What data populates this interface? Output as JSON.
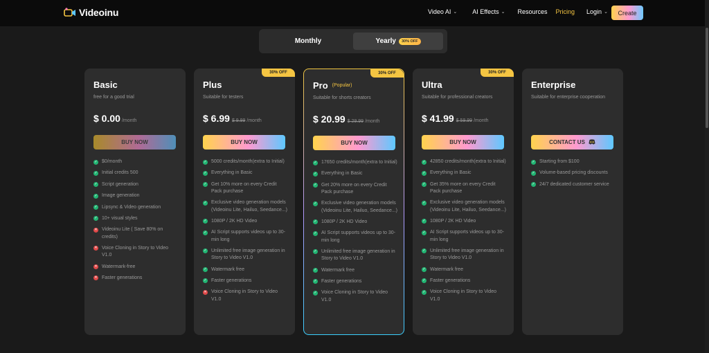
{
  "header": {
    "logo_text": "Videoinu",
    "nav": [
      {
        "label": "Video AI",
        "chevron": true,
        "active": false
      },
      {
        "label": "AI Effects",
        "chevron": true,
        "active": false
      },
      {
        "label": "Resources",
        "chevron": false,
        "active": false
      },
      {
        "label": "Pricing",
        "chevron": false,
        "active": true
      },
      {
        "label": "Login",
        "chevron": true,
        "active": false
      }
    ],
    "create_label": "Create"
  },
  "billing_toggle": {
    "monthly_label": "Monthly",
    "yearly_label": "Yearly",
    "yearly_badge": "30% OFF",
    "selected": "Yearly"
  },
  "plans": [
    {
      "name": "Basic",
      "popular": "",
      "badge": "",
      "description": "free for a good trial",
      "price": "$ 0.00",
      "old_price": "",
      "period": "/month",
      "button": "BUY NOW",
      "button_icon": "",
      "features": [
        {
          "text": "$0/month",
          "included": true
        },
        {
          "text": "Initial credits 500",
          "included": true
        },
        {
          "text": "Script generation",
          "included": true
        },
        {
          "text": "Image generation",
          "included": true
        },
        {
          "text": "Lipsync & Video generation",
          "included": true
        },
        {
          "text": "10+ visual styles",
          "included": true
        },
        {
          "text": "Videoinu Lite ( Save 80% on credits)",
          "included": false
        },
        {
          "text": "Voice Cloning in Story to Video V1.0",
          "included": false
        },
        {
          "text": "Watermark-free",
          "included": false
        },
        {
          "text": "Faster generations",
          "included": false
        }
      ]
    },
    {
      "name": "Plus",
      "popular": "",
      "badge": "30% OFF",
      "description": "Suitable for testers",
      "price": "$ 6.99",
      "old_price": "$ 9.99",
      "period": "/month",
      "button": "BUY NOW",
      "button_icon": "",
      "features": [
        {
          "text": "5000 credits/month(extra to Initial)",
          "included": true
        },
        {
          "text": "Everything in Basic",
          "included": true
        },
        {
          "text": "Get 10% more on every Credit Pack purchase",
          "included": true
        },
        {
          "text": "Exclusive video generation models (Videoinu Lite, Hailuo, Seedance...)",
          "included": true
        },
        {
          "text": "1080P / 2K HD Video",
          "included": true
        },
        {
          "text": "AI Script supports videos up to 30-min long",
          "included": true
        },
        {
          "text": "Unlimited free image generation in Story to Video V1.0",
          "included": true
        },
        {
          "text": "Watermark free",
          "included": true
        },
        {
          "text": "Faster generations",
          "included": true
        },
        {
          "text": "Voice Cloning in Story to Video V1.0",
          "included": false
        }
      ]
    },
    {
      "name": "Pro",
      "popular": "(Popular)",
      "badge": "30% OFF",
      "description": "Suitable for shorts creators",
      "price": "$ 20.99",
      "old_price": "$ 29.99",
      "period": "/month",
      "button": "BUY NOW",
      "button_icon": "",
      "features": [
        {
          "text": "17650 credits/month(extra to Initial)",
          "included": true
        },
        {
          "text": "Everything in Basic",
          "included": true
        },
        {
          "text": "Get 20% more on every Credit Pack purchase",
          "included": true
        },
        {
          "text": "Exclusive video generation models (Videoinu Lite, Hailuo, Seedance...)",
          "included": true
        },
        {
          "text": "1080P / 2K HD Video",
          "included": true
        },
        {
          "text": "AI Script supports videos up to 30-min long",
          "included": true
        },
        {
          "text": "Unlimited free image generation in Story to Video V1.0",
          "included": true
        },
        {
          "text": "Watermark free",
          "included": true
        },
        {
          "text": "Faster generations",
          "included": true
        },
        {
          "text": "Voice Cloning in Story to Video V1.0",
          "included": true
        }
      ]
    },
    {
      "name": "Ultra",
      "popular": "",
      "badge": "30% OFF",
      "description": "Suitable for professional creators",
      "price": "$ 41.99",
      "old_price": "$ 59.99",
      "period": "/month",
      "button": "BUY NOW",
      "button_icon": "",
      "features": [
        {
          "text": "42850 credits/month(extra to Initial)",
          "included": true
        },
        {
          "text": "Everything in Basic",
          "included": true
        },
        {
          "text": "Get 35% more on every Credit Pack purchase",
          "included": true
        },
        {
          "text": "Exclusive video generation models (Videoinu Lite, Hailuo, Seedance...)",
          "included": true
        },
        {
          "text": "1080P / 2K HD Video",
          "included": true
        },
        {
          "text": "AI Script supports videos up to 30-min long",
          "included": true
        },
        {
          "text": "Unlimited free image generation in Story to Video V1.0",
          "included": true
        },
        {
          "text": "Watermark free",
          "included": true
        },
        {
          "text": "Faster generations",
          "included": true
        },
        {
          "text": "Voice Cloning in Story to Video V1.0",
          "included": true
        }
      ]
    },
    {
      "name": "Enterprise",
      "popular": "",
      "badge": "",
      "description": "Suitable for enterprise cooperation",
      "price": "",
      "old_price": "",
      "period": "",
      "button": "CONTACT US",
      "button_icon": "discord-icon",
      "features": [
        {
          "text": "Starting from $100",
          "included": true
        },
        {
          "text": "Volume-based pricing discounts",
          "included": true
        },
        {
          "text": "24/7 dedicated customer service",
          "included": true
        }
      ]
    }
  ],
  "colors": {
    "accent_yellow": "#f5c542",
    "check_green": "#22b573",
    "cross_red": "#e04848",
    "card_bg": "#2d2d2d"
  }
}
